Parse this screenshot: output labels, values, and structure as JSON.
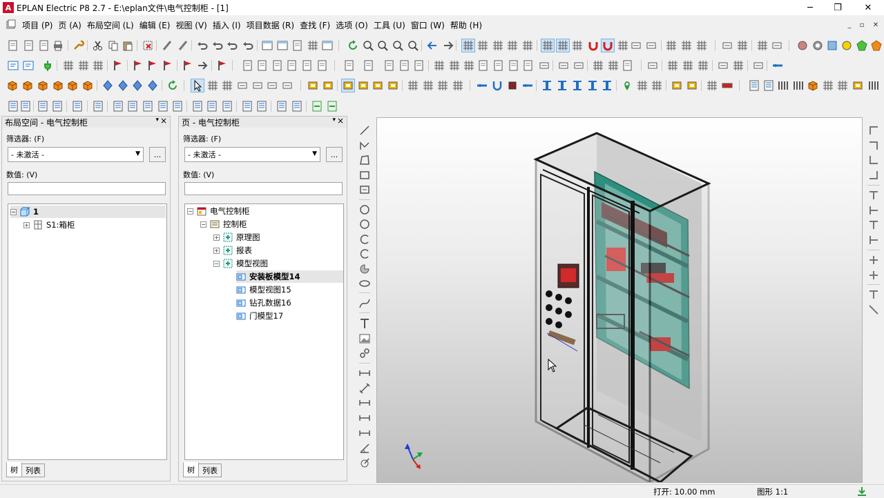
{
  "window": {
    "title": "EPLAN Electric P8 2.7 - E:\\eplan文件\\电气控制柜 - [1]",
    "app_icon_letter": "A",
    "controls": {
      "minimize": "─",
      "restore": "❐",
      "close": "✕"
    }
  },
  "menu": {
    "items": [
      "项目 (P)",
      "页 (A)",
      "布局空间 (L)",
      "编辑 (E)",
      "视图 (V)",
      "插入 (I)",
      "项目数据 (R)",
      "查找 (F)",
      "选项 (O)",
      "工具 (U)",
      "窗口 (W)",
      "帮助 (H)"
    ],
    "mdi_controls": [
      "_",
      "▫",
      "✕"
    ]
  },
  "layout_panel": {
    "title": "布局空间 - 电气控制柜",
    "pin": "▾",
    "close": "×",
    "filter_label": "筛选器: (F)",
    "filter_value": "- 未激活 -",
    "filter_more": "...",
    "value_label": "数值: (V)",
    "tree": {
      "root": "1",
      "child": "S1:箱柜"
    },
    "tabs": [
      "树",
      "列表"
    ]
  },
  "pages_panel": {
    "title": "页 - 电气控制柜",
    "pin": "▾",
    "close": "×",
    "filter_label": "筛选器: (F)",
    "filter_value": "- 未激活 -",
    "filter_more": "...",
    "value_label": "数值: (V)",
    "tree": {
      "project": "电气控制柜",
      "cabinet": "控制柜",
      "schematic": "原理图",
      "reports": "报表",
      "model_views": "模型视图",
      "pages": [
        "安装板模型14",
        "模型视图15",
        "钻孔数据16",
        "门模型17"
      ]
    },
    "tabs": [
      "树",
      "列表"
    ]
  },
  "status": {
    "grid": "打开: 10.00 mm",
    "scale": "图形 1:1"
  },
  "colors": {
    "accent_blue": "#1f6fc5",
    "toolbar_green": "#2e9b3e",
    "cabinet_teal": "#2f8f7f",
    "app_red": "#c8102e"
  }
}
